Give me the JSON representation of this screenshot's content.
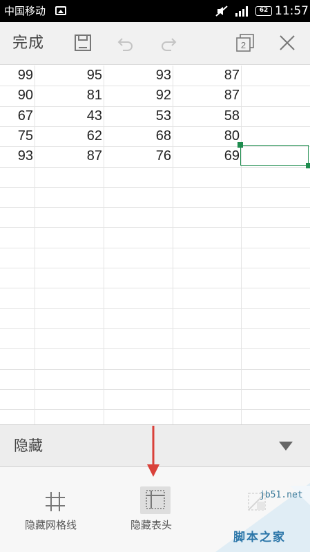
{
  "status_bar": {
    "carrier": "中国移动",
    "battery": "62",
    "time": "11:57"
  },
  "toolbar": {
    "done_label": "完成",
    "icons": [
      "save-icon",
      "undo-icon",
      "redo-icon",
      "pages-icon",
      "close-icon"
    ],
    "pages_count": "2"
  },
  "sheet": {
    "rows": [
      [
        "99",
        "95",
        "93",
        "87"
      ],
      [
        "90",
        "81",
        "92",
        "87"
      ],
      [
        "67",
        "43",
        "53",
        "58"
      ],
      [
        "75",
        "62",
        "68",
        "80"
      ],
      [
        "93",
        "87",
        "76",
        "69"
      ]
    ],
    "selection_color": "#1e8c4e"
  },
  "hide_panel": {
    "title": "隐藏",
    "options": [
      {
        "label": "隐藏网格线",
        "icon": "grid-icon"
      },
      {
        "label": "隐藏表头",
        "icon": "hide-header-icon"
      },
      {
        "label": "",
        "icon": "disabled-option-icon"
      }
    ]
  },
  "annotation": {
    "arrow_color": "#d9413a"
  },
  "watermark": {
    "site": "jb51.net",
    "name": "脚本之家"
  }
}
